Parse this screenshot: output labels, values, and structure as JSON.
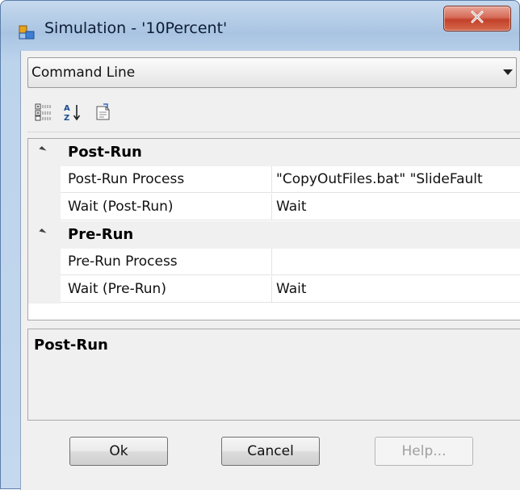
{
  "window": {
    "title": "Simulation - '10Percent'",
    "close_symbol": "X"
  },
  "dropdown": {
    "selected": "Command Line"
  },
  "toolbar": {
    "icons": [
      "categorized-icon",
      "alphabetical-icon",
      "property-pages-icon"
    ]
  },
  "grid": {
    "categories": [
      {
        "label": "Post-Run",
        "properties": [
          {
            "name": "Post-Run Process",
            "value": "\"CopyOutFiles.bat\" \"SlideFault"
          },
          {
            "name": "Wait (Post-Run)",
            "value": "Wait"
          }
        ]
      },
      {
        "label": "Pre-Run",
        "properties": [
          {
            "name": "Pre-Run Process",
            "value": ""
          },
          {
            "name": "Wait (Pre-Run)",
            "value": "Wait"
          }
        ]
      }
    ]
  },
  "help": {
    "title": "Post-Run"
  },
  "buttons": {
    "ok": "Ok",
    "cancel": "Cancel",
    "help": "Help..."
  },
  "colors": {
    "title_bar": "#b8cfe8",
    "close_button": "#c84a33"
  }
}
